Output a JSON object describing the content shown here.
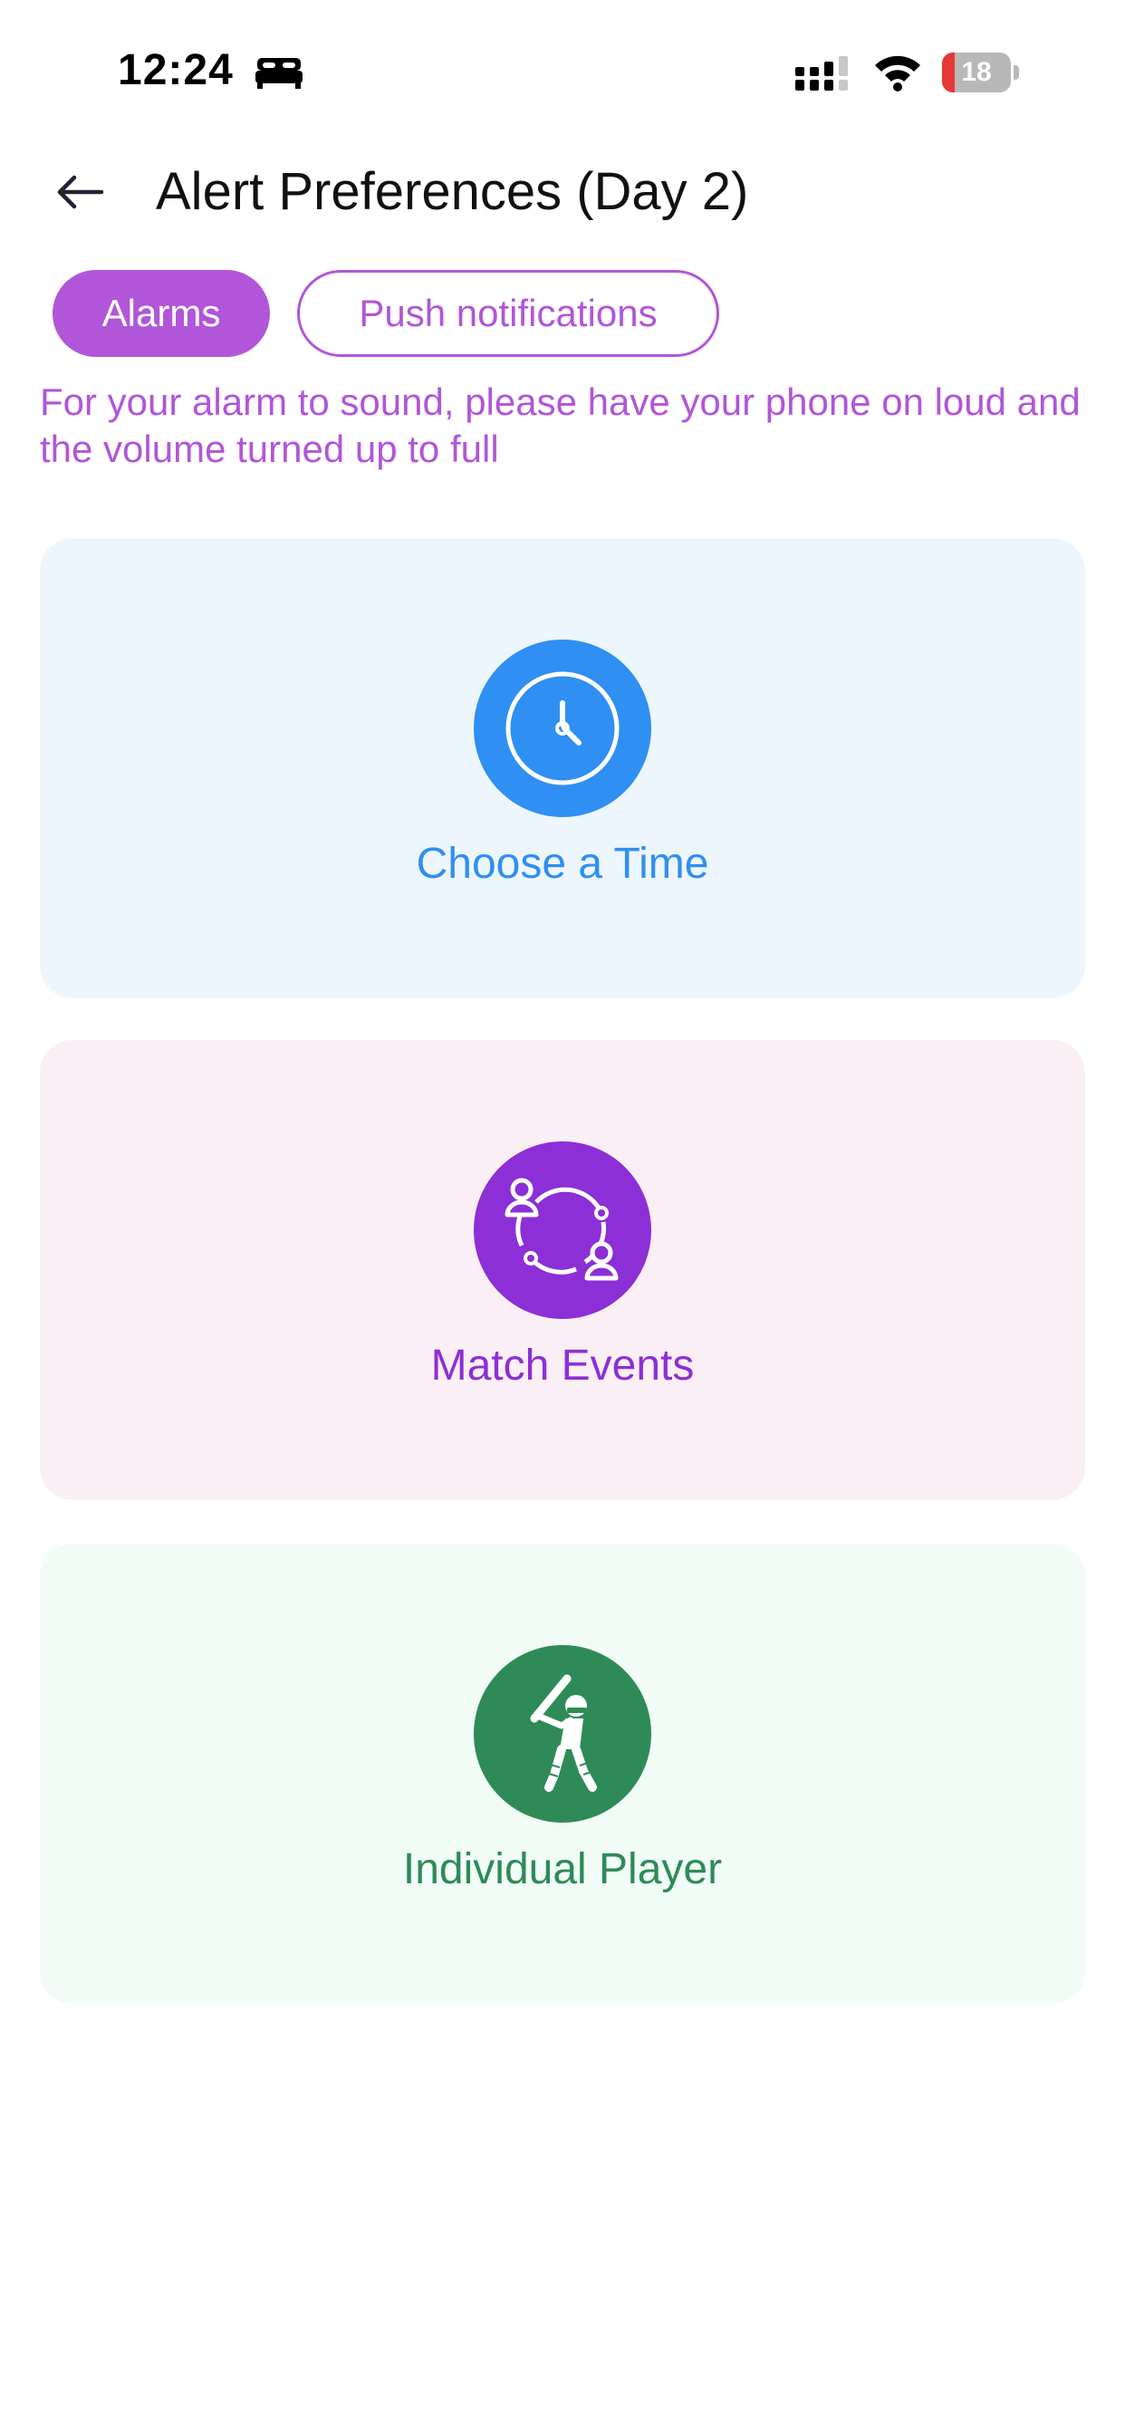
{
  "status_bar": {
    "time": "12:24",
    "battery_level": "18",
    "icons": [
      "bed-icon",
      "cellular-signal-icon",
      "wifi-icon",
      "battery-icon"
    ]
  },
  "header": {
    "back_icon": "arrow-left-icon",
    "title": "Alert Preferences (Day 2)"
  },
  "tabs": [
    {
      "label": "Alarms",
      "active": true
    },
    {
      "label": "Push notifications",
      "active": false
    }
  ],
  "info_text": "For your alarm to sound, please have your phone on loud and the volume turned up to full",
  "cards": [
    {
      "label": "Choose a Time",
      "icon": "clock-icon",
      "accent": "#2f8ff2",
      "background": "#eef6fd"
    },
    {
      "label": "Match Events",
      "icon": "users-cycle-icon",
      "accent": "#8c2fd6",
      "background": "#fbeff6"
    },
    {
      "label": "Individual Player",
      "icon": "cricket-batsman-icon",
      "accent": "#2e8b57",
      "background": "#f1fcf6"
    }
  ],
  "colors": {
    "primary": "#b156d8",
    "battery_low": "#e53935"
  }
}
